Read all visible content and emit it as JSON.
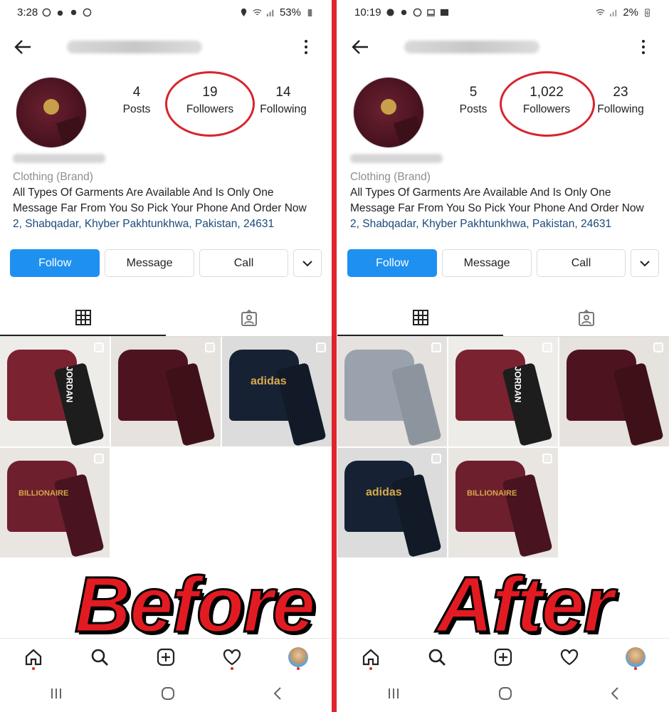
{
  "before": {
    "status_time": "3:28",
    "battery": "53%",
    "posts": "4",
    "followers": "19",
    "following": "14",
    "caption": "Before",
    "posts_grid": [
      {
        "name": "post-jordan",
        "shirt": "#7a2230",
        "pants": "#1d1d1d",
        "bg": "#eeece9",
        "logo": "JORDAN",
        "logo_color": "#ffffff"
      },
      {
        "name": "post-maroon",
        "shirt": "#4d1420",
        "pants": "#3e1119",
        "bg": "#e6e2de",
        "logo": "",
        "logo_color": "#c9a04a"
      },
      {
        "name": "post-adidas",
        "shirt": "#162233",
        "pants": "#111a26",
        "bg": "#dcdcdc",
        "logo": "adidas",
        "logo_color": "#d9a94c"
      },
      {
        "name": "post-billionaire",
        "shirt": "#6e1f2d",
        "pants": "#4a1320",
        "bg": "#e9e6e2",
        "logo": "BILLIONAIRE",
        "logo_color": "#d7a64a"
      }
    ]
  },
  "after": {
    "status_time": "10:19",
    "battery": "2%",
    "posts": "5",
    "followers": "1,022",
    "following": "23",
    "caption": "After",
    "posts_grid": [
      {
        "name": "post-grey",
        "shirt": "#9aa3ad",
        "pants": "#8c959e",
        "bg": "#e4e1de",
        "logo": "",
        "logo_color": "#ffffff"
      },
      {
        "name": "post-jordan",
        "shirt": "#7a2230",
        "pants": "#1d1d1d",
        "bg": "#eeece9",
        "logo": "JORDAN",
        "logo_color": "#ffffff"
      },
      {
        "name": "post-maroon",
        "shirt": "#4d1420",
        "pants": "#3e1119",
        "bg": "#e6e2de",
        "logo": "",
        "logo_color": "#c9a04a"
      },
      {
        "name": "post-adidas",
        "shirt": "#162233",
        "pants": "#111a26",
        "bg": "#dcdcdc",
        "logo": "adidas",
        "logo_color": "#d9a94c"
      },
      {
        "name": "post-billionaire",
        "shirt": "#6e1f2d",
        "pants": "#4a1320",
        "bg": "#e9e6e2",
        "logo": "BILLIONAIRE",
        "logo_color": "#d7a64a"
      }
    ]
  },
  "labels": {
    "posts": "Posts",
    "followers": "Followers",
    "following": "Following",
    "category": "Clothing (Brand)",
    "bio_line1": "All Types Of Garments Are Available And Is Only One",
    "bio_line2": "Message Far From You So Pick Your Phone And Order Now",
    "address": "2, Shabqadar, Khyber Pakhtunkhwa, Pakistan, 24631",
    "follow": "Follow",
    "message": "Message",
    "call": "Call"
  },
  "colors": {
    "accent_blue": "#1e90f0",
    "highlight_red": "#e0242c",
    "link_blue": "#1a4b7a"
  },
  "icons": [
    "back-arrow-icon",
    "more-vert-icon",
    "grid-icon",
    "tagged-icon",
    "home-icon",
    "search-icon",
    "add-icon",
    "heart-icon",
    "profile-avatar",
    "recent-apps-icon",
    "home-circle-icon",
    "back-chevron-icon"
  ]
}
